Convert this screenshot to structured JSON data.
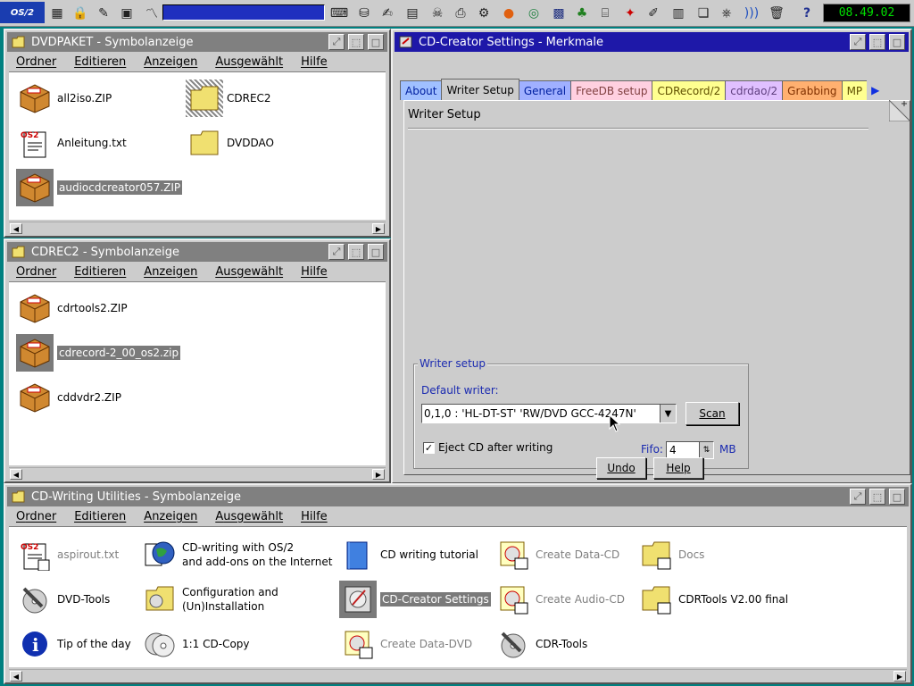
{
  "launchbar": {
    "clock": "08.49.02",
    "logo_text": "OS/2"
  },
  "win_dvdpaket": {
    "title": "DVDPAKET - Symbolanzeige",
    "menu": [
      "Ordner",
      "Editieren",
      "Anzeigen",
      "Ausgewählt",
      "Hilfe"
    ],
    "items": [
      "all2iso.ZIP",
      "CDREC2",
      "Anleitung.txt",
      "DVDDAO",
      "audiocdcreator057.ZIP"
    ]
  },
  "win_cdrec2": {
    "title": "CDREC2 - Symbolanzeige",
    "menu": [
      "Ordner",
      "Editieren",
      "Anzeigen",
      "Ausgewählt",
      "Hilfe"
    ],
    "items": [
      "cdrtools2.ZIP",
      "cdrecord-2_00_os2.zip",
      "cddvdr2.ZIP"
    ]
  },
  "win_settings": {
    "title": "CD-Creator Settings - Merkmale",
    "tabs": [
      "About",
      "Writer Setup",
      "General",
      "FreeDB setup",
      "CDRecord/2",
      "cdrdao/2",
      "Grabbing",
      "MP"
    ],
    "page_title": "Writer Setup",
    "group_label": "Writer setup",
    "default_writer_label": "Default writer:",
    "default_writer_value": "0,1,0 : 'HL-DT-ST' 'RW/DVD GCC-4247N'",
    "scan_label": "Scan",
    "eject_label": "Eject CD after writing",
    "fifo_label": "Fifo:",
    "fifo_value": "4",
    "fifo_unit": "MB",
    "undo_label": "Undo",
    "help_label": "Help"
  },
  "win_utilities": {
    "title": "CD-Writing Utilities - Symbolanzeige",
    "menu": [
      "Ordner",
      "Editieren",
      "Anzeigen",
      "Ausgewählt",
      "Hilfe"
    ],
    "items": {
      "aspirout": "aspirout.txt",
      "cdwriting_l1": "CD-writing with OS/2",
      "cdwriting_l2": "and add-ons on the Internet",
      "tutorial": "CD writing tutorial",
      "create_data_cd": "Create Data-CD",
      "docs": "Docs",
      "dvd_tools": "DVD-Tools",
      "config_l1": "Configuration and",
      "config_l2": "(Un)Installation",
      "cdcreator": "CD-Creator Settings",
      "create_audio_cd": "Create Audio-CD",
      "cdrtools_v2": "CDRTools V2.00 final",
      "tip": "Tip of the day",
      "copy": "1:1 CD-Copy",
      "create_data_dvd": "Create Data-DVD",
      "cdr_tools": "CDR-Tools"
    }
  }
}
